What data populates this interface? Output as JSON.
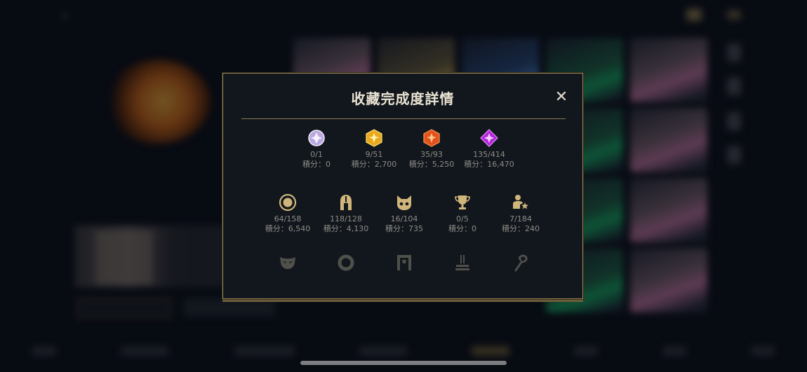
{
  "modal": {
    "title": "收藏完成度詳情",
    "close_symbol": "✕",
    "gem_row": [
      {
        "icon": "white-gem-icon",
        "count": "0/1",
        "points": "積分：0"
      },
      {
        "icon": "gold-gem-icon",
        "count": "9/51",
        "points": "積分：2,700"
      },
      {
        "icon": "orange-gem-icon",
        "count": "35/93",
        "points": "積分：5,250"
      },
      {
        "icon": "purple-gem-icon",
        "count": "135/414",
        "points": "積分：16,470"
      }
    ],
    "category_row": [
      {
        "icon": "emblem-icon",
        "count": "64/158",
        "points": "積分：6,540"
      },
      {
        "icon": "helmet-icon",
        "count": "118/128",
        "points": "積分：4,130"
      },
      {
        "icon": "creature-icon",
        "count": "16/104",
        "points": "積分：735"
      },
      {
        "icon": "trophy-icon",
        "count": "0/5",
        "points": "積分：0"
      },
      {
        "icon": "player-star-icon",
        "count": "7/184",
        "points": "積分：240"
      }
    ],
    "locked_row": [
      {
        "icon": "mask-icon"
      },
      {
        "icon": "ring-icon"
      },
      {
        "icon": "frame-icon"
      },
      {
        "icon": "pedestal-icon"
      },
      {
        "icon": "hook-icon"
      }
    ]
  },
  "colors": {
    "modal_border": "#a18b58",
    "modal_background": "#12171e",
    "text_primary": "#e9e3d2",
    "text_secondary": "#8e8c84",
    "gold_accent": "#cfb57a"
  }
}
